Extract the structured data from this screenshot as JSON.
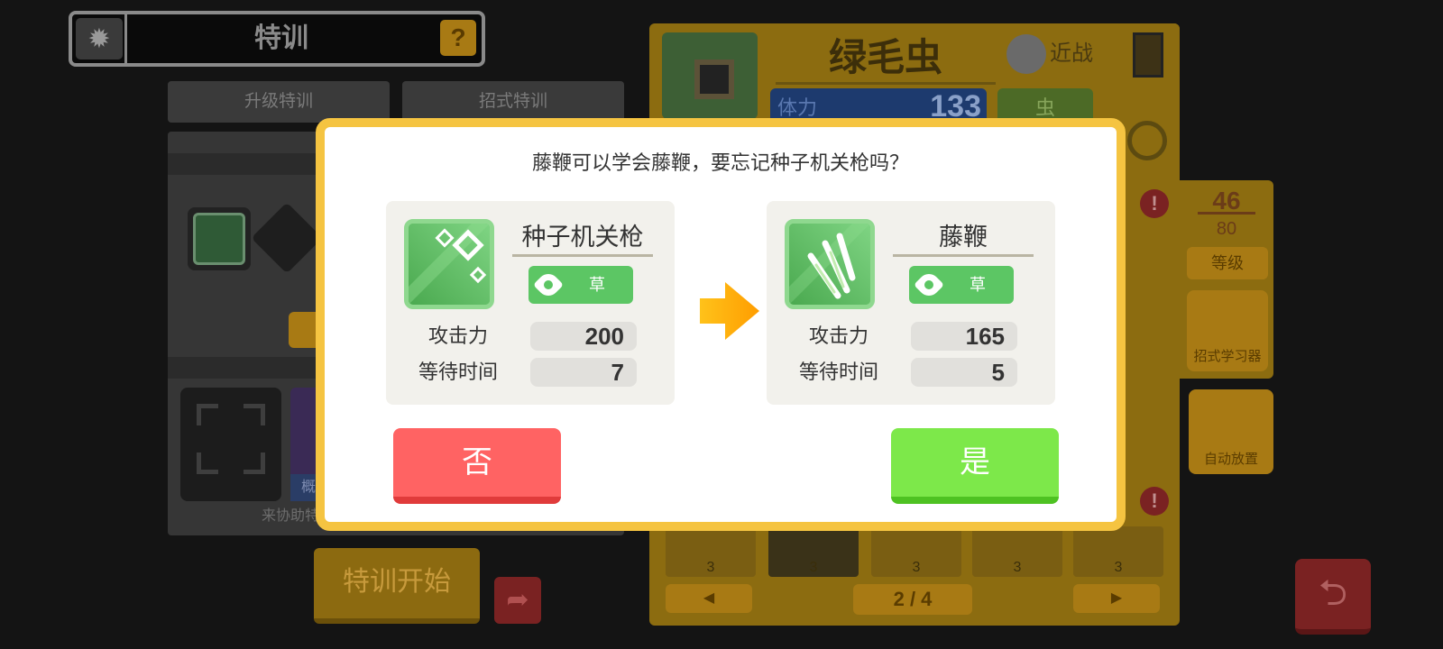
{
  "header": {
    "title": "特训",
    "help_symbol": "?"
  },
  "tabs": [
    {
      "label": "升级特训"
    },
    {
      "label": "招式特训"
    }
  ],
  "left_panel": {
    "assist_text": "来协助特",
    "poke_label": "概"
  },
  "start_button": "特训开始",
  "pokemon": {
    "name": "绿毛虫",
    "attack_style": "近战",
    "hp_label": "体力",
    "hp": "133",
    "type": "虫"
  },
  "stats": {
    "level": "46",
    "level_max": "80",
    "level_label": "等级"
  },
  "side_buttons": {
    "move_learner": "招式学习器",
    "auto_place": "自动放置"
  },
  "move_slots": [
    {
      "count": "3"
    },
    {
      "count": "3"
    },
    {
      "count": "3"
    },
    {
      "count": "3"
    },
    {
      "count": "3"
    }
  ],
  "pager": {
    "label": "2 / 4",
    "prev": "◀",
    "next": "▶"
  },
  "warn_symbol": "!",
  "modal": {
    "question": "藤鞭可以学会藤鞭，要忘记种子机关枪吗？",
    "old_move": {
      "name": "种子机关枪",
      "type": "草",
      "attack_label": "攻击力",
      "attack": "200",
      "wait_label": "等待时间",
      "wait": "7"
    },
    "new_move": {
      "name": "藤鞭",
      "type": "草",
      "attack_label": "攻击力",
      "attack": "165",
      "wait_label": "等待时间",
      "wait": "5"
    },
    "no_label": "否",
    "yes_label": "是"
  },
  "colors": {
    "modal_border": "#f5c441",
    "grass_type": "#5cc664",
    "no_button": "#ff6363",
    "yes_button": "#7de84a",
    "arrow": "#ffb300"
  },
  "icons": {
    "settings": "gear-icon",
    "help": "question-icon",
    "arrow": "arrow-right-icon",
    "back": "return-icon",
    "share": "share-icon",
    "bookmark": "bookmark-icon",
    "search": "magnify-icon"
  }
}
